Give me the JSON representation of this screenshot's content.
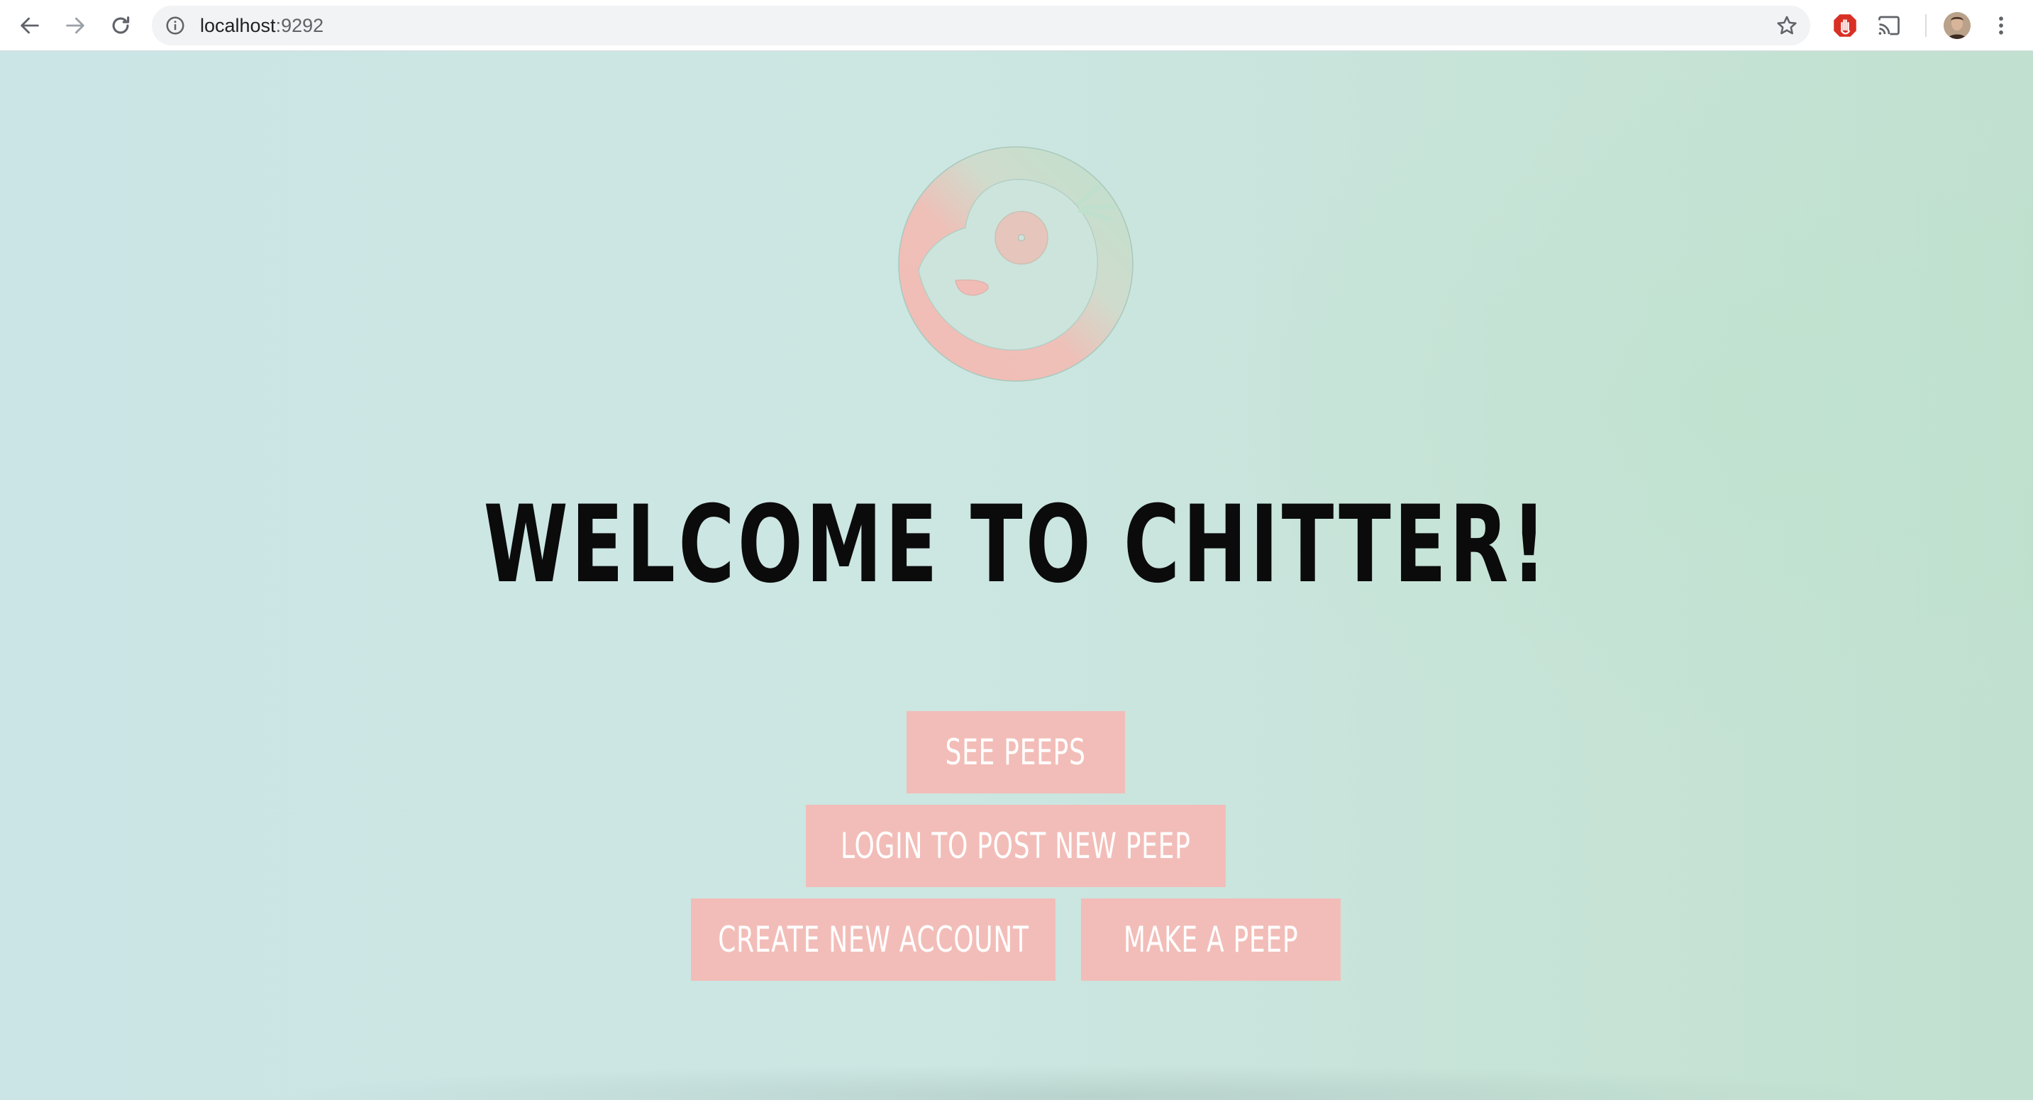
{
  "browser": {
    "url_host": "localhost",
    "url_port": ":9292"
  },
  "page": {
    "heading": "WELCOME TO CHITTER!",
    "buttons": {
      "see_peeps": "SEE PEEPS",
      "login_post": "LOGIN TO POST NEW PEEP",
      "create_account": "CREATE NEW ACCOUNT",
      "make_peep": "MAKE A PEEP"
    }
  },
  "colors": {
    "button_bg": "#f2bdb8",
    "button_text": "#ffffff",
    "heading": "#0b0b0b",
    "bg_left": "#cbe5e6",
    "bg_right": "#c1e0cf"
  },
  "icons": {
    "back": "arrow-left-icon",
    "forward": "arrow-right-icon",
    "reload": "reload-icon",
    "site_info": "info-icon",
    "bookmark": "star-icon",
    "extension": "stop-hand-icon",
    "cast": "cast-icon",
    "profile": "avatar",
    "menu": "kebab-menu-icon",
    "logo": "chitter-bird-logo"
  }
}
